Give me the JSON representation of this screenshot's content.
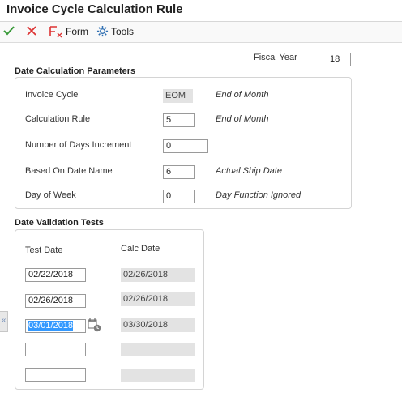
{
  "window": {
    "title": "Invoice Cycle Calculation Rule"
  },
  "toolbar": {
    "form_label": "Form",
    "tools_label": "Tools"
  },
  "header": {
    "fiscal_year_label": "Fiscal Year",
    "fiscal_year_value": "18"
  },
  "date_calc": {
    "title": "Date Calculation Parameters",
    "invoice_cycle": {
      "label": "Invoice Cycle",
      "value": "EOM",
      "description": "End of Month"
    },
    "calculation_rule": {
      "label": "Calculation Rule",
      "value": "5",
      "description": "End of Month"
    },
    "days_increment": {
      "label": "Number of Days Increment",
      "value": "0"
    },
    "based_on_date": {
      "label": "Based On Date Name",
      "value": "6",
      "description": "Actual Ship Date"
    },
    "day_of_week": {
      "label": "Day of Week",
      "value": "0",
      "description": "Day Function Ignored"
    }
  },
  "validation": {
    "title": "Date Validation Tests",
    "test_date_header": "Test Date",
    "calc_date_header": "Calc Date",
    "rows": [
      {
        "test": "02/22/2018",
        "calc": "02/26/2018"
      },
      {
        "test": "02/26/2018",
        "calc": "02/26/2018"
      },
      {
        "test": "03/01/2018",
        "calc": "03/30/2018"
      },
      {
        "test": "",
        "calc": ""
      },
      {
        "test": "",
        "calc": ""
      }
    ]
  },
  "colors": {
    "ok": "#3a9a3a",
    "cancel": "#d33",
    "selection": "#3399ff",
    "accent": "#2f6fb2"
  }
}
